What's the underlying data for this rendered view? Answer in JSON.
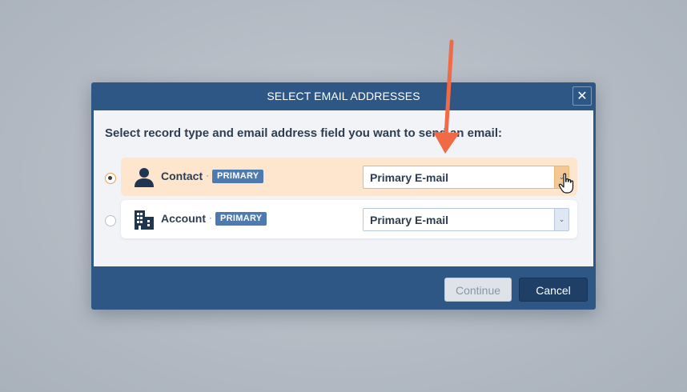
{
  "dialog": {
    "title": "SELECT EMAIL ADDRESSES",
    "close_label": "✕",
    "instruction": "Select record type and email address field you want to send an email:"
  },
  "rows": [
    {
      "label": "Contact",
      "separator": "·",
      "badge": "PRIMARY",
      "icon": "person-icon",
      "selected": true,
      "field_value": "Primary E-mail"
    },
    {
      "label": "Account",
      "separator": "·",
      "badge": "PRIMARY",
      "icon": "building-icon",
      "selected": false,
      "field_value": "Primary E-mail"
    }
  ],
  "footer": {
    "continue_label": "Continue",
    "cancel_label": "Cancel"
  },
  "dropdown_arrow": "⌄",
  "colors": {
    "header": "#2f5786",
    "selected_row": "#fde6cd",
    "badge": "#4d7bb0",
    "annotation_arrow": "#f06a45",
    "cancel_button": "#1f3f66"
  }
}
